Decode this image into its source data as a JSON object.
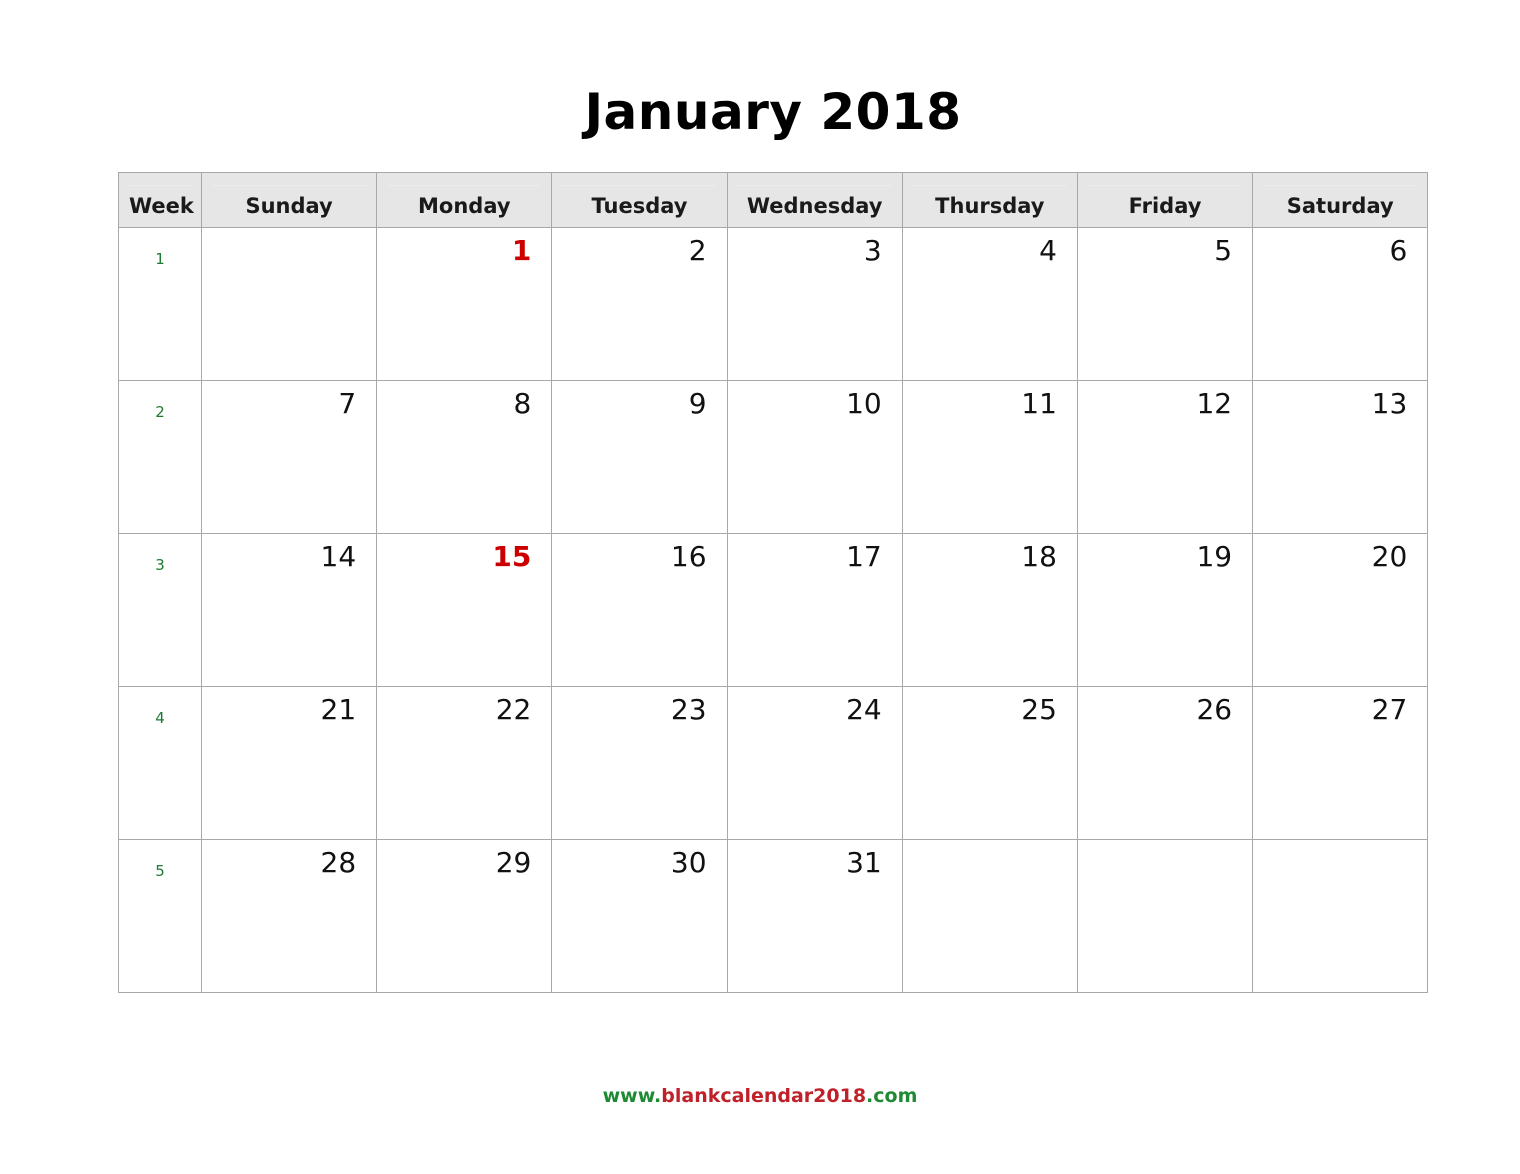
{
  "title": "January 2018",
  "headers": {
    "week": "Week",
    "days": [
      "Sunday",
      "Monday",
      "Tuesday",
      "Wednesday",
      "Thursday",
      "Friday",
      "Saturday"
    ]
  },
  "colors": {
    "holiday": "#cc0000",
    "week_number": "#1f7a31",
    "header_background": "#e6e6e6",
    "grid_border": "#a8a8a8",
    "day_number": "#111111",
    "footer_green": "#1f8a33",
    "footer_red": "#c0202a"
  },
  "weeks": [
    {
      "number": "1",
      "days": [
        {
          "label": "",
          "holiday": false
        },
        {
          "label": "1",
          "holiday": true
        },
        {
          "label": "2",
          "holiday": false
        },
        {
          "label": "3",
          "holiday": false
        },
        {
          "label": "4",
          "holiday": false
        },
        {
          "label": "5",
          "holiday": false
        },
        {
          "label": "6",
          "holiday": false
        }
      ]
    },
    {
      "number": "2",
      "days": [
        {
          "label": "7",
          "holiday": false
        },
        {
          "label": "8",
          "holiday": false
        },
        {
          "label": "9",
          "holiday": false
        },
        {
          "label": "10",
          "holiday": false
        },
        {
          "label": "11",
          "holiday": false
        },
        {
          "label": "12",
          "holiday": false
        },
        {
          "label": "13",
          "holiday": false
        }
      ]
    },
    {
      "number": "3",
      "days": [
        {
          "label": "14",
          "holiday": false
        },
        {
          "label": "15",
          "holiday": true
        },
        {
          "label": "16",
          "holiday": false
        },
        {
          "label": "17",
          "holiday": false
        },
        {
          "label": "18",
          "holiday": false
        },
        {
          "label": "19",
          "holiday": false
        },
        {
          "label": "20",
          "holiday": false
        }
      ]
    },
    {
      "number": "4",
      "days": [
        {
          "label": "21",
          "holiday": false
        },
        {
          "label": "22",
          "holiday": false
        },
        {
          "label": "23",
          "holiday": false
        },
        {
          "label": "24",
          "holiday": false
        },
        {
          "label": "25",
          "holiday": false
        },
        {
          "label": "26",
          "holiday": false
        },
        {
          "label": "27",
          "holiday": false
        }
      ]
    },
    {
      "number": "5",
      "days": [
        {
          "label": "28",
          "holiday": false
        },
        {
          "label": "29",
          "holiday": false
        },
        {
          "label": "30",
          "holiday": false
        },
        {
          "label": "31",
          "holiday": false
        },
        {
          "label": "",
          "holiday": false
        },
        {
          "label": "",
          "holiday": false
        },
        {
          "label": "",
          "holiday": false
        }
      ]
    }
  ],
  "footer": {
    "prefix": "www.",
    "name": "blankcalendar2018",
    "suffix": ".com"
  }
}
